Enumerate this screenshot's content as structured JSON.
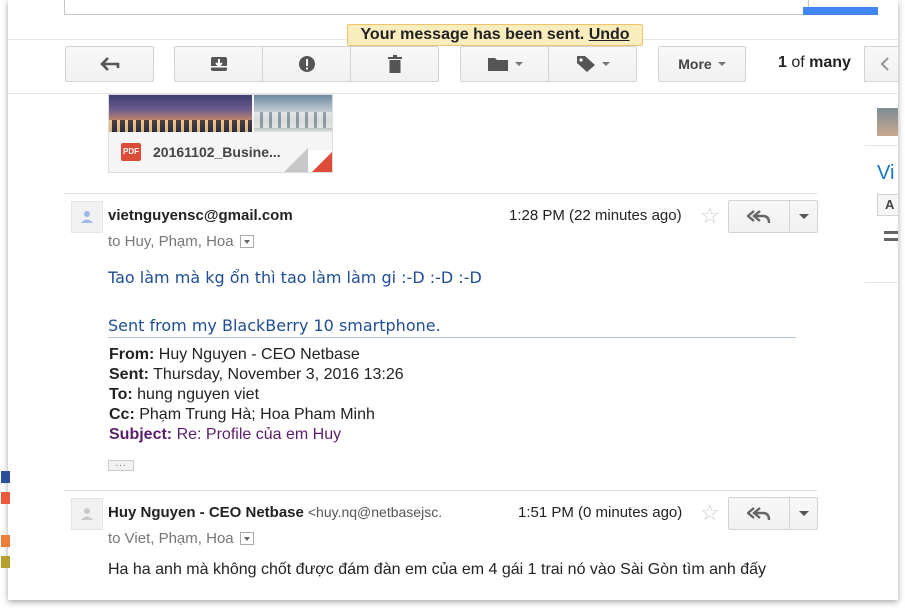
{
  "notification": {
    "text": "Your message has been sent.",
    "undo": "Undo"
  },
  "toolbar": {
    "back_icon": "back-arrow-icon",
    "archive_icon": "archive-icon",
    "spam_icon": "report-spam-icon",
    "delete_icon": "trash-icon",
    "move_icon": "folder-icon",
    "labels_icon": "label-tag-icon",
    "more_label": "More",
    "count_current": "1",
    "count_of": "of",
    "count_total": "many"
  },
  "attachment": {
    "filename": "20161102_Busine...",
    "type_label": "PDF"
  },
  "messages": [
    {
      "sender": "vietnguyensc@gmail.com",
      "sender_email": "",
      "time": "1:28 PM (22 minutes ago)",
      "recipients": "to Huy, Phạm, Hoa",
      "body_line1": "Tao làm mà kg ổn thì tao làm làm gi :-D :-D :-D",
      "body_line2": "Sent from my BlackBerry 10 smartphone.",
      "quote": {
        "from_label": "From:",
        "from": "Huy Nguyen - CEO Netbase",
        "sent_label": "Sent:",
        "sent": "Thursday, November 3, 2016 13:26",
        "to_label": "To:",
        "to": "hung nguyen viet",
        "cc_label": "Cc:",
        "cc": "Phạm Trung Hà; Hoa Pham Minh",
        "subject_label": "Subject:",
        "subject": "Re: Profile của em Huy"
      }
    },
    {
      "sender": "Huy Nguyen - CEO Netbase",
      "sender_email": "<huy.nq@netbasejsc.",
      "time": "1:51 PM (0 minutes ago)",
      "recipients": "to Viet, Phạm, Hoa",
      "body_line1": "Ha ha anh mà không chốt được đám đàn em của em 4 gái 1 trai nó vào Sài Gòn tìm anh đấy"
    }
  ],
  "right_panel": {
    "name_fragment": "Vi",
    "button_fragment": "A"
  },
  "colors": {
    "accent_blue": "#4285f4",
    "notice_bg": "#f9edbe",
    "body_text_blue": "#1f4e96",
    "subject_purple": "#5b1e6b"
  }
}
